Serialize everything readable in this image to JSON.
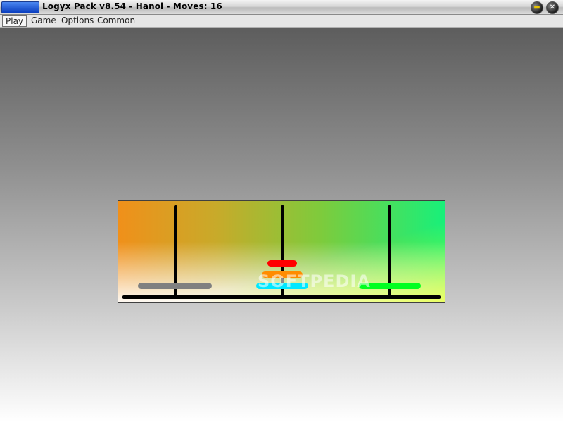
{
  "window": {
    "title": "Logyx Pack v8.54 - Hanoi - Moves: 16",
    "minimize_icon": "minimize-icon",
    "close_icon": "close-icon"
  },
  "menu": {
    "items": [
      {
        "label": "Play",
        "active": true
      },
      {
        "label": "Game",
        "active": false
      },
      {
        "label": "Options",
        "active": false
      },
      {
        "label": "Common",
        "active": false
      }
    ]
  },
  "game": {
    "name": "Hanoi",
    "moves": 16,
    "pegs": [
      {
        "disks": [
          {
            "size": 4,
            "color": "#808080"
          }
        ]
      },
      {
        "disks": [
          {
            "size": 3,
            "color": "#00e8ff"
          },
          {
            "size": 2,
            "color": "#ff8c00"
          },
          {
            "size": 1,
            "color": "#ff0000"
          }
        ]
      },
      {
        "disks": [
          {
            "size": 4,
            "color": "#00ff20"
          }
        ]
      }
    ]
  },
  "watermark": "SOFTPEDIA"
}
